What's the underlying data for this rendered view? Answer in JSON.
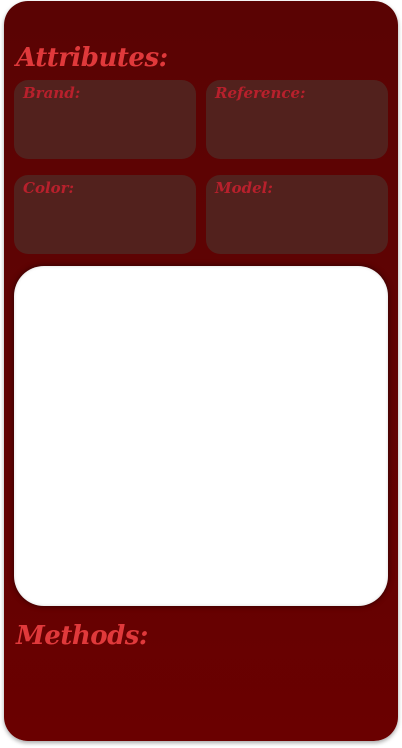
{
  "card": {
    "attributes_heading": "Attributes:",
    "methods_heading": "Methods:",
    "attributes": [
      {
        "label": "Brand:",
        "value": ""
      },
      {
        "label": "Reference:",
        "value": ""
      },
      {
        "label": "Color:",
        "value": ""
      },
      {
        "label": "Model:",
        "value": ""
      }
    ]
  },
  "colors": {
    "card_background": "#610303",
    "heading": "#e0393b",
    "attribute_label": "#b8202c",
    "attribute_box": "#52211d",
    "image_panel": "#ffffff"
  }
}
